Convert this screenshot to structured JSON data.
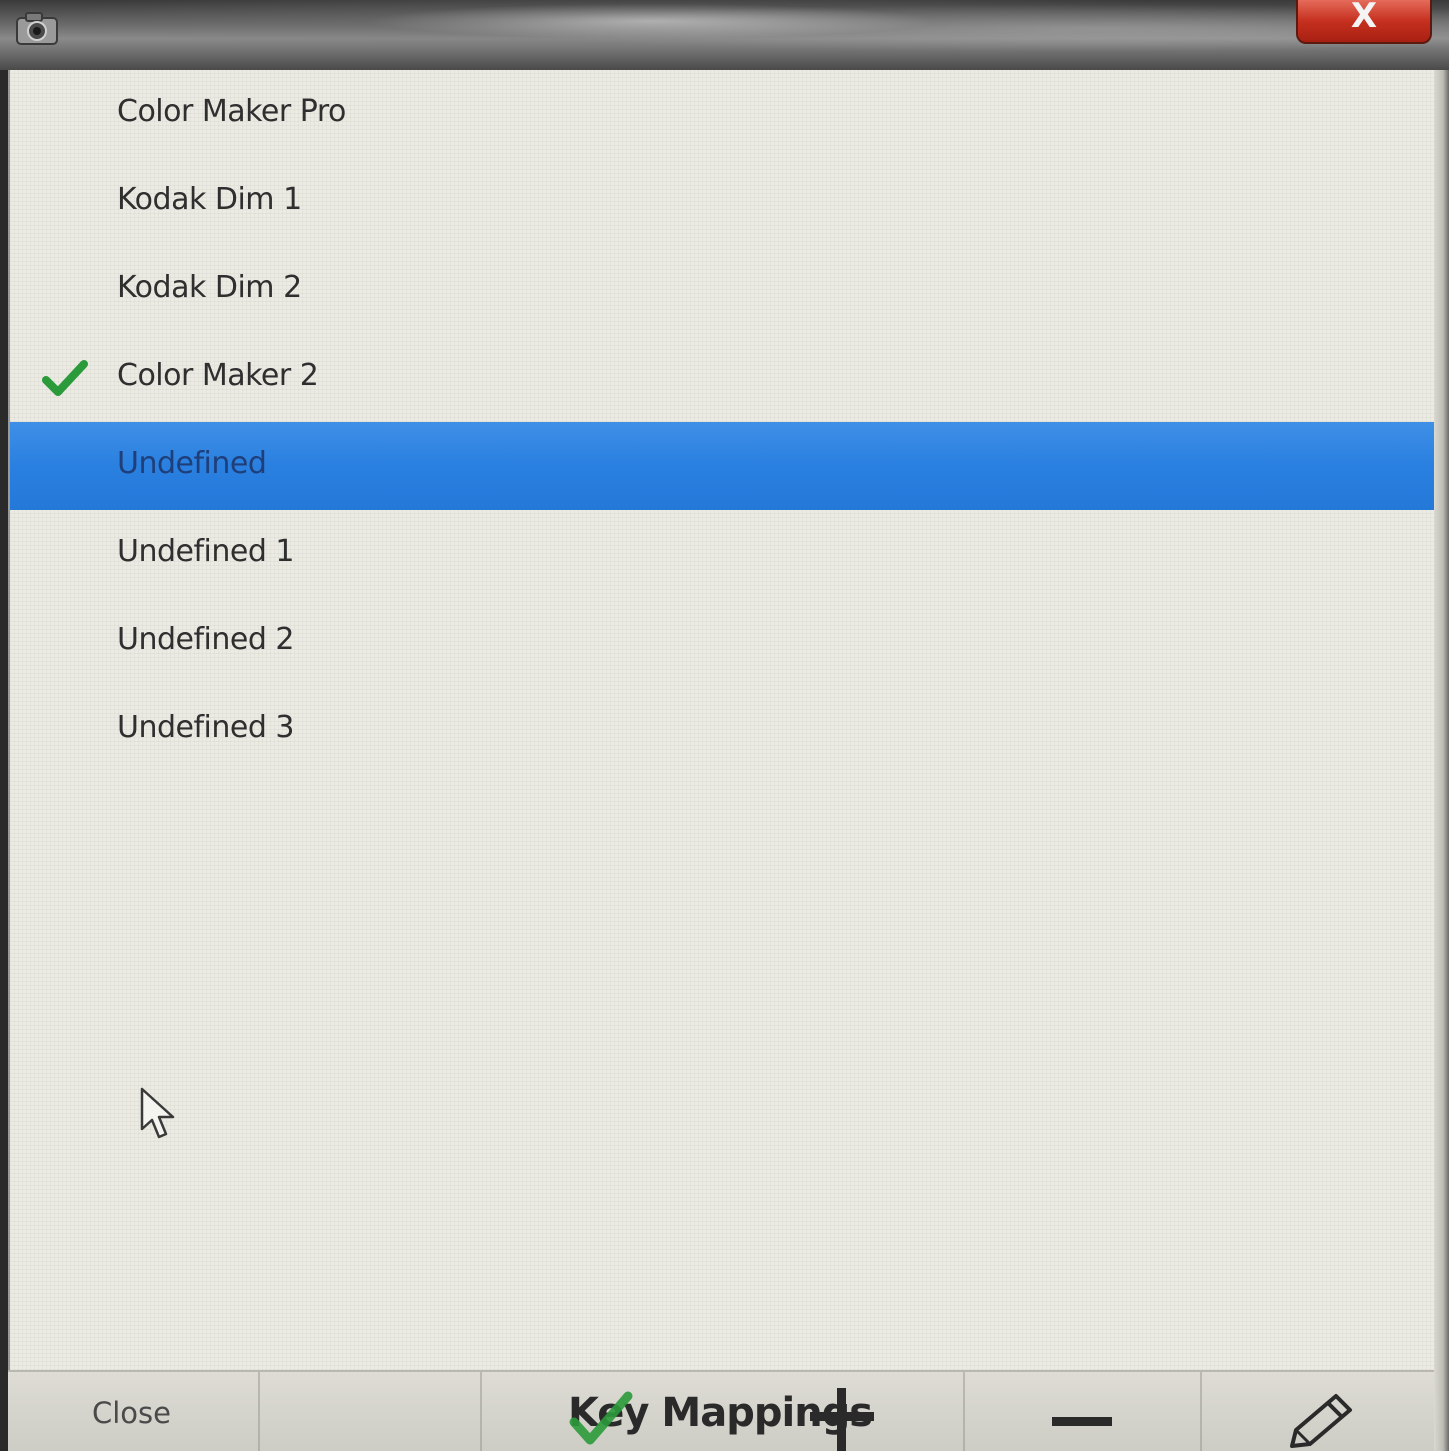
{
  "window": {
    "close_glyph": "X"
  },
  "list": {
    "items": [
      {
        "label": "Color Maker Pro",
        "checked": false,
        "selected": false
      },
      {
        "label": "Kodak Dim 1",
        "checked": false,
        "selected": false
      },
      {
        "label": "Kodak Dim 2",
        "checked": false,
        "selected": false
      },
      {
        "label": "Color Maker 2",
        "checked": true,
        "selected": false
      },
      {
        "label": "Undefined",
        "checked": false,
        "selected": true
      },
      {
        "label": "Undefined 1",
        "checked": false,
        "selected": false
      },
      {
        "label": "Undefined 2",
        "checked": false,
        "selected": false
      },
      {
        "label": "Undefined 3",
        "checked": false,
        "selected": false
      }
    ]
  },
  "toolbar": {
    "close_label": "Close",
    "title": "Key Mappings"
  },
  "icons": {
    "app": "camera-icon",
    "check": "checkmark-icon",
    "cursor": "mouse-pointer-icon",
    "add": "plus-icon",
    "remove": "minus-icon",
    "edit": "pencil-icon"
  },
  "colors": {
    "selection": "#2a80e0",
    "check": "#2a9a3a",
    "close_button": "#c6301f",
    "list_background": "#ebebe4"
  }
}
